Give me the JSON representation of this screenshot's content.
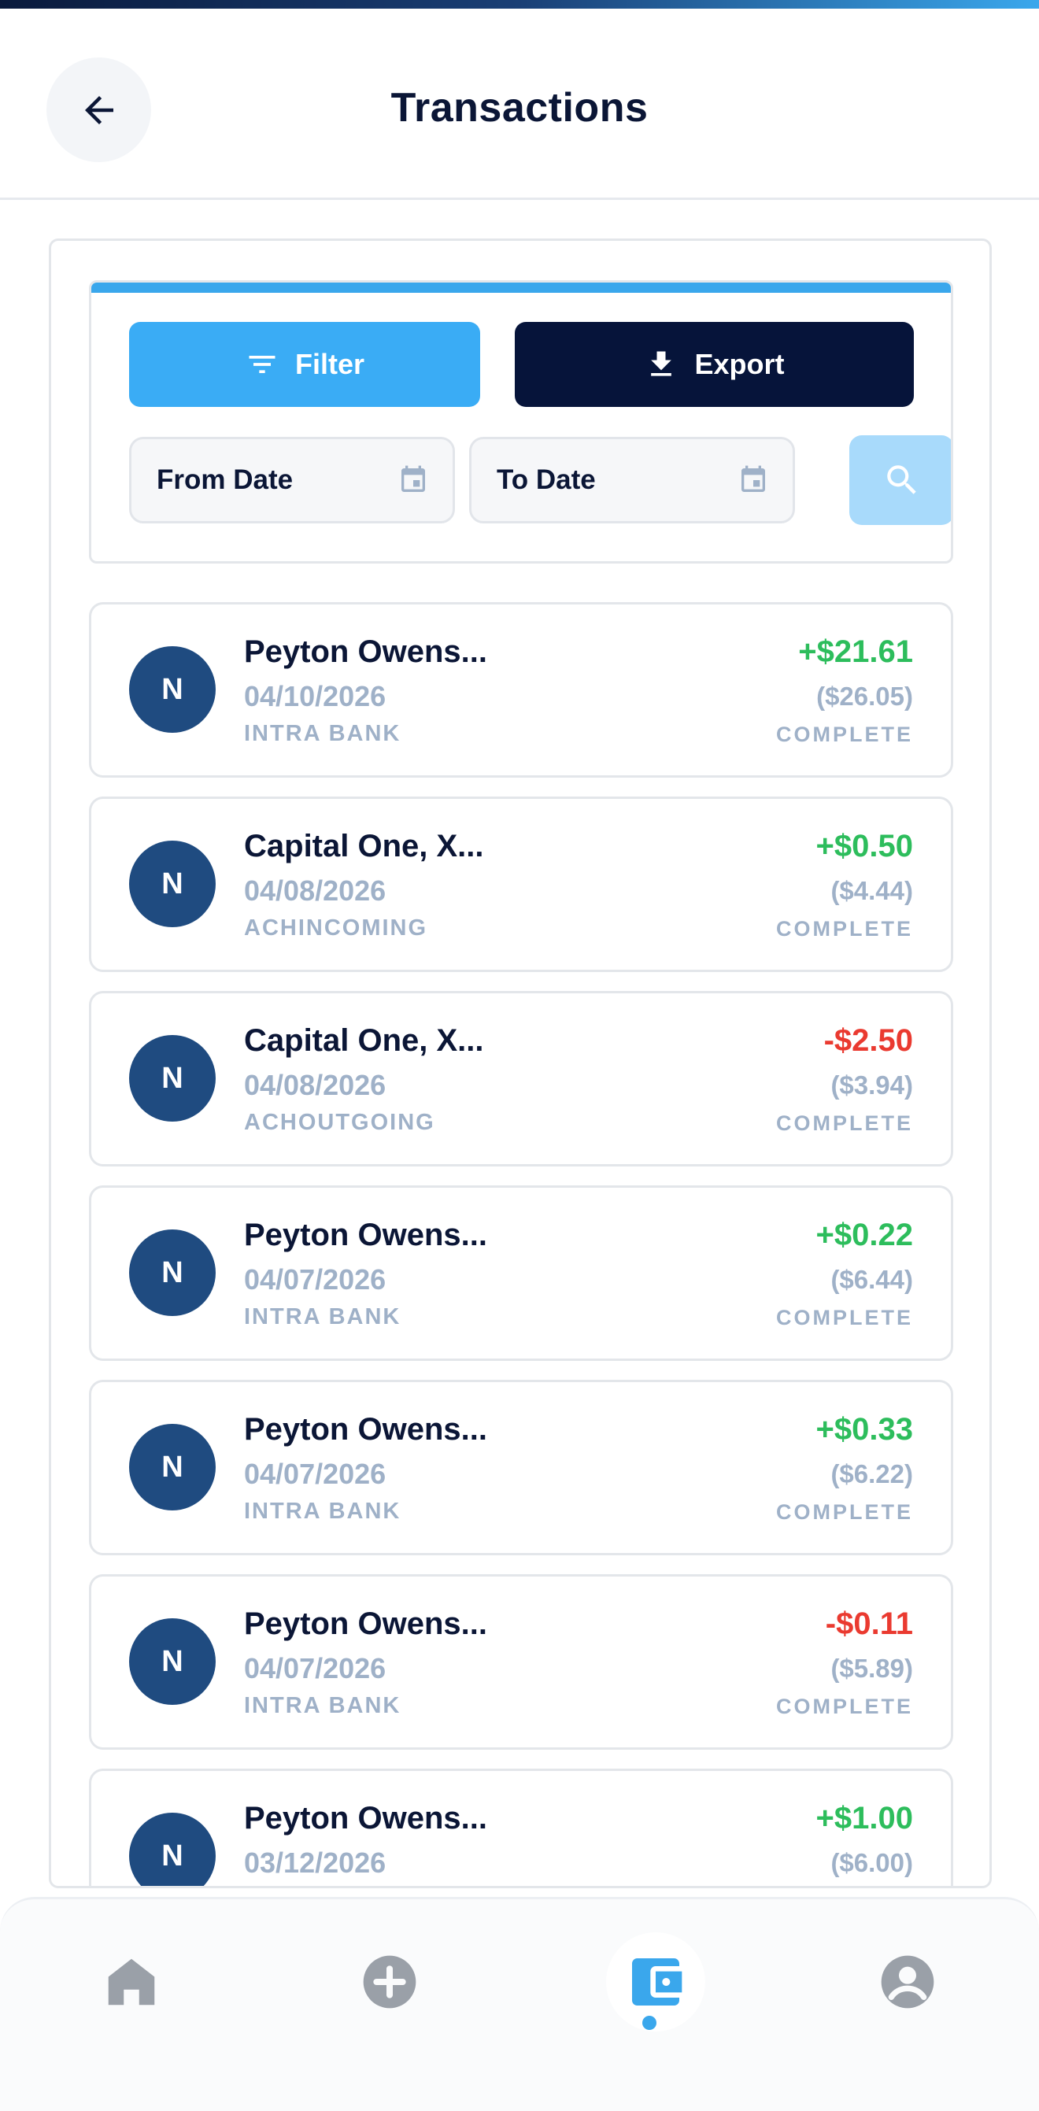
{
  "header": {
    "title": "Transactions",
    "back_icon": "arrow-left-icon"
  },
  "filters": {
    "filter_label": "Filter",
    "export_label": "Export",
    "from_date_placeholder": "From Date",
    "to_date_placeholder": "To Date"
  },
  "transactions": [
    {
      "initial": "N",
      "name": "Peyton Owens...",
      "date": "04/10/2026",
      "type": "INTRA BANK",
      "amount": "+$21.61",
      "direction": "credit",
      "balance": "($26.05)",
      "status": "COMPLETE"
    },
    {
      "initial": "N",
      "name": "Capital One, X...",
      "date": "04/08/2026",
      "type": "ACHINCOMING",
      "amount": "+$0.50",
      "direction": "credit",
      "balance": "($4.44)",
      "status": "COMPLETE"
    },
    {
      "initial": "N",
      "name": "Capital One, X...",
      "date": "04/08/2026",
      "type": "ACHOUTGOING",
      "amount": "-$2.50",
      "direction": "debit",
      "balance": "($3.94)",
      "status": "COMPLETE"
    },
    {
      "initial": "N",
      "name": "Peyton Owens...",
      "date": "04/07/2026",
      "type": "INTRA BANK",
      "amount": "+$0.22",
      "direction": "credit",
      "balance": "($6.44)",
      "status": "COMPLETE"
    },
    {
      "initial": "N",
      "name": "Peyton Owens...",
      "date": "04/07/2026",
      "type": "INTRA BANK",
      "amount": "+$0.33",
      "direction": "credit",
      "balance": "($6.22)",
      "status": "COMPLETE"
    },
    {
      "initial": "N",
      "name": "Peyton Owens...",
      "date": "04/07/2026",
      "type": "INTRA BANK",
      "amount": "-$0.11",
      "direction": "debit",
      "balance": "($5.89)",
      "status": "COMPLETE"
    },
    {
      "initial": "N",
      "name": "Peyton Owens...",
      "date": "03/12/2026",
      "type": "",
      "amount": "+$1.00",
      "direction": "credit",
      "balance": "($6.00)",
      "status": ""
    }
  ],
  "colors": {
    "accent": "#3aa7ec",
    "navy": "#06143a",
    "credit": "#2dbd5c",
    "debit": "#ea3a30",
    "muted": "#9fb1c8",
    "avatar": "#1f4b80"
  },
  "bottom_nav": {
    "items": [
      {
        "icon": "home-icon",
        "active": false
      },
      {
        "icon": "add-circle-icon",
        "active": false
      },
      {
        "icon": "wallet-icon",
        "active": true
      },
      {
        "icon": "profile-icon",
        "active": false
      }
    ]
  }
}
